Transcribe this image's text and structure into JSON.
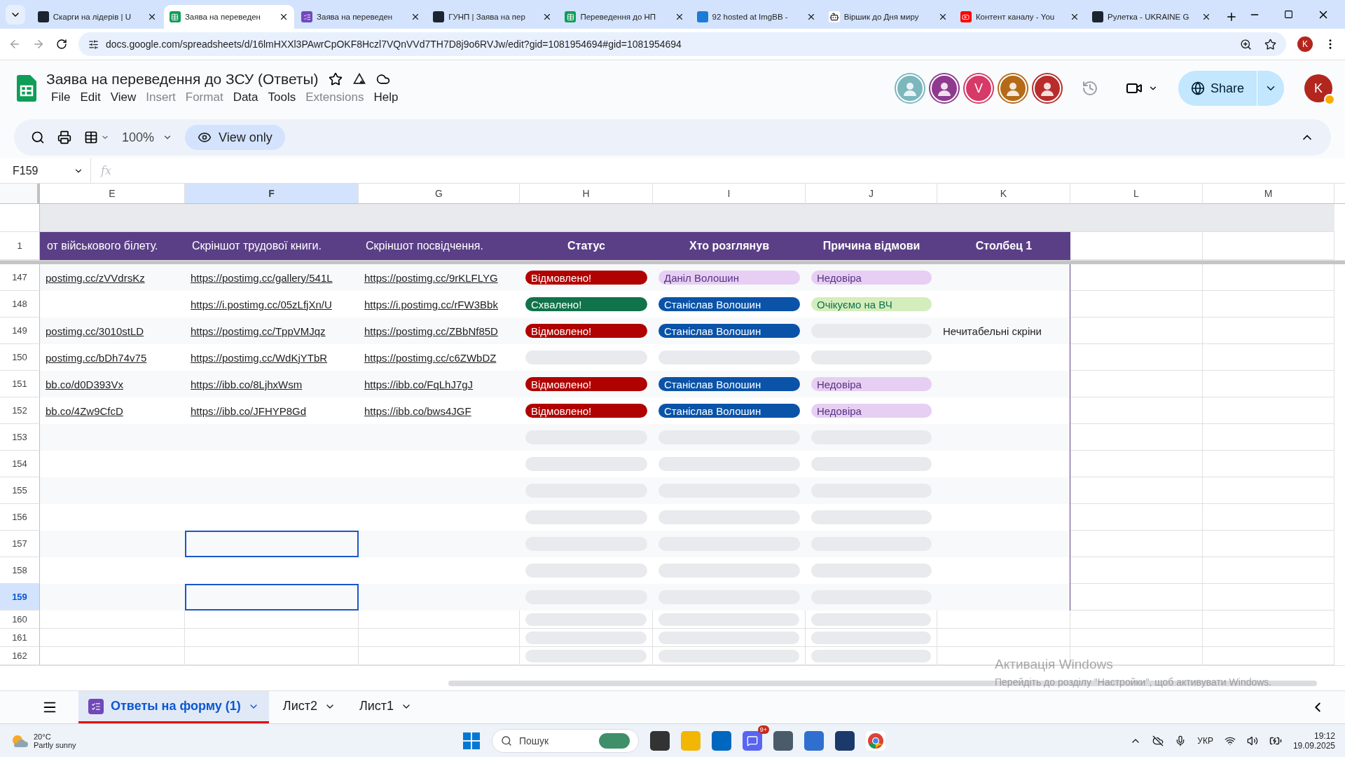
{
  "browser": {
    "tabs": [
      {
        "title": "Скарги на лідерів | U",
        "selected": false,
        "kind": "dark"
      },
      {
        "title": "Заява на переведен",
        "selected": true,
        "kind": "sheets"
      },
      {
        "title": "Заява на переведен",
        "selected": false,
        "kind": "forms"
      },
      {
        "title": "ГУНП | Заява на пер",
        "selected": false,
        "kind": "dark"
      },
      {
        "title": "Переведення до НП",
        "selected": false,
        "kind": "sheets"
      },
      {
        "title": "92 hosted at ImgBB -",
        "selected": false,
        "kind": "ibb"
      },
      {
        "title": "Віршик до Дня миру",
        "selected": false,
        "kind": "ai"
      },
      {
        "title": "Контент каналу - You",
        "selected": false,
        "kind": "video"
      },
      {
        "title": "Рулетка - UKRAINE G",
        "selected": false,
        "kind": "dark"
      }
    ],
    "url": "docs.google.com/spreadsheets/d/16lmHXXl3PAwrCpOKF8Hczl7VQnVVd7TH7D8j9o6RVJw/edit?gid=1081954694#gid=1081954694",
    "profile": "K"
  },
  "doc": {
    "title": "Заява на переведення до ЗСУ (Ответы)",
    "menu": [
      {
        "label": "File",
        "disabled": false
      },
      {
        "label": "Edit",
        "disabled": false
      },
      {
        "label": "View",
        "disabled": false
      },
      {
        "label": "Insert",
        "disabled": true
      },
      {
        "label": "Format",
        "disabled": true
      },
      {
        "label": "Data",
        "disabled": false
      },
      {
        "label": "Tools",
        "disabled": false
      },
      {
        "label": "Extensions",
        "disabled": true
      },
      {
        "label": "Help",
        "disabled": false
      }
    ],
    "collaborators": [
      {
        "kind": "picture"
      },
      {
        "kind": "picture"
      },
      {
        "kind": "letter",
        "letter": "V"
      },
      {
        "kind": "picture"
      },
      {
        "kind": "picture"
      }
    ],
    "share": "Share",
    "account": "K"
  },
  "toolbar": {
    "zoom": "100%",
    "mode": "View only"
  },
  "formula_bar": {
    "cell": "F159",
    "fx": "fx"
  },
  "columns": [
    {
      "letter": "E",
      "selected": false
    },
    {
      "letter": "F",
      "selected": true
    },
    {
      "letter": "G",
      "selected": false
    },
    {
      "letter": "H",
      "selected": false
    },
    {
      "letter": "I",
      "selected": false
    },
    {
      "letter": "J",
      "selected": false
    },
    {
      "letter": "K",
      "selected": false
    },
    {
      "letter": "L",
      "selected": false
    },
    {
      "letter": "M",
      "selected": false
    }
  ],
  "header_row": {
    "number": "1",
    "cells": [
      "от військового білету.",
      "Скріншот трудової книги.",
      "Скріншот посвідчення.",
      "Статус",
      "Хто розглянув",
      "Причина відмови",
      "Столбец 1"
    ]
  },
  "rows": [
    {
      "number": "147",
      "selected": false,
      "outlined": false,
      "e": "postimg.cc/zVVdrsKz",
      "f": "https://postimg.cc/gallery/541L",
      "g": "https://postimg.cc/9rKLFLYG",
      "status": {
        "kind": "red",
        "text": "Відмовлено!"
      },
      "reviewer": {
        "kind": "lilac",
        "text": "Даніл Волошин"
      },
      "reason": {
        "kind": "lilac",
        "text": "Недовіра"
      }
    },
    {
      "number": "148",
      "selected": false,
      "outlined": false,
      "f": "https://i.postimg.cc/05zLfjXn/U",
      "g": "https://i.postimg.cc/rFW3Bbk",
      "status": {
        "kind": "green",
        "text": "Схвалено!"
      },
      "reviewer": {
        "kind": "blue",
        "text": "Станіслав Волошин"
      },
      "reason": {
        "kind": "lightgreen",
        "text": "Очікуємо на ВЧ"
      }
    },
    {
      "number": "149",
      "selected": false,
      "outlined": false,
      "e": "postimg.cc/3010stLD",
      "f": "https://postimg.cc/TppVMJqz",
      "g": "https://postimg.cc/ZBbNf85D",
      "status": {
        "kind": "red",
        "text": "Відмовлено!"
      },
      "reviewer": {
        "kind": "blue",
        "text": "Станіслав Волошин"
      },
      "reason": {
        "kind": "empty"
      },
      "k": "Нечитабельні скріни"
    },
    {
      "number": "150",
      "selected": false,
      "outlined": false,
      "e": "postimg.cc/bDh74v75",
      "f": "https://postimg.cc/WdKjYTbR",
      "g": "https://postimg.cc/c6ZWbDZ",
      "status": {
        "kind": "empty"
      },
      "reviewer": {
        "kind": "empty"
      },
      "reason": {
        "kind": "empty"
      }
    },
    {
      "number": "151",
      "selected": false,
      "outlined": false,
      "e": "bb.co/d0D393Vx",
      "f": "https://ibb.co/8LjhxWsm",
      "g": "https://ibb.co/FqLhJ7gJ",
      "status": {
        "kind": "red",
        "text": "Відмовлено!"
      },
      "reviewer": {
        "kind": "blue",
        "text": "Станіслав Волошин"
      },
      "reason": {
        "kind": "lilac",
        "text": "Недовіра"
      }
    },
    {
      "number": "152",
      "selected": false,
      "outlined": false,
      "e": "bb.co/4Zw9CfcD",
      "f": "https://ibb.co/JFHYP8Gd",
      "g": "https://ibb.co/bws4JGF",
      "status": {
        "kind": "red",
        "text": "Відмовлено!"
      },
      "reviewer": {
        "kind": "blue",
        "text": "Станіслав Волошин"
      },
      "reason": {
        "kind": "lilac",
        "text": "Недовіра"
      }
    },
    {
      "number": "153",
      "selected": false,
      "outlined": false,
      "status": {
        "kind": "empty"
      },
      "reviewer": {
        "kind": "empty"
      },
      "reason": {
        "kind": "empty"
      }
    },
    {
      "number": "154",
      "selected": false,
      "outlined": false,
      "status": {
        "kind": "empty"
      },
      "reviewer": {
        "kind": "empty"
      },
      "reason": {
        "kind": "empty"
      }
    },
    {
      "number": "155",
      "selected": false,
      "outlined": false,
      "status": {
        "kind": "empty"
      },
      "reviewer": {
        "kind": "empty"
      },
      "reason": {
        "kind": "empty"
      }
    },
    {
      "number": "156",
      "selected": false,
      "outlined": false,
      "status": {
        "kind": "empty"
      },
      "reviewer": {
        "kind": "empty"
      },
      "reason": {
        "kind": "empty"
      }
    },
    {
      "number": "157",
      "selected": false,
      "outlined": true,
      "status": {
        "kind": "empty"
      },
      "reviewer": {
        "kind": "empty"
      },
      "reason": {
        "kind": "empty"
      }
    },
    {
      "number": "158",
      "selected": false,
      "outlined": false,
      "status": {
        "kind": "empty"
      },
      "reviewer": {
        "kind": "empty"
      },
      "reason": {
        "kind": "empty"
      }
    },
    {
      "number": "159",
      "selected": true,
      "outlined": true,
      "status": {
        "kind": "empty"
      },
      "reviewer": {
        "kind": "empty"
      },
      "reason": {
        "kind": "empty"
      }
    }
  ],
  "extra_rows": [
    "160",
    "161",
    "162"
  ],
  "activation": {
    "title": "Активація Windows",
    "text": "Перейдіть до розділу \"Настройки\", щоб активувати Windows."
  },
  "sheets": [
    {
      "label": "Ответы на форму (1)",
      "selected": true,
      "kind": "form"
    },
    {
      "label": "Лист2",
      "selected": false,
      "kind": "plain"
    },
    {
      "label": "Лист1",
      "selected": false,
      "kind": "plain"
    }
  ],
  "taskbar": {
    "temperature": "20°C",
    "weather": "Partly sunny",
    "search": "Пошук",
    "badge": "9+",
    "language": "УКР",
    "time": "19:12",
    "date": "19.09.2025"
  }
}
